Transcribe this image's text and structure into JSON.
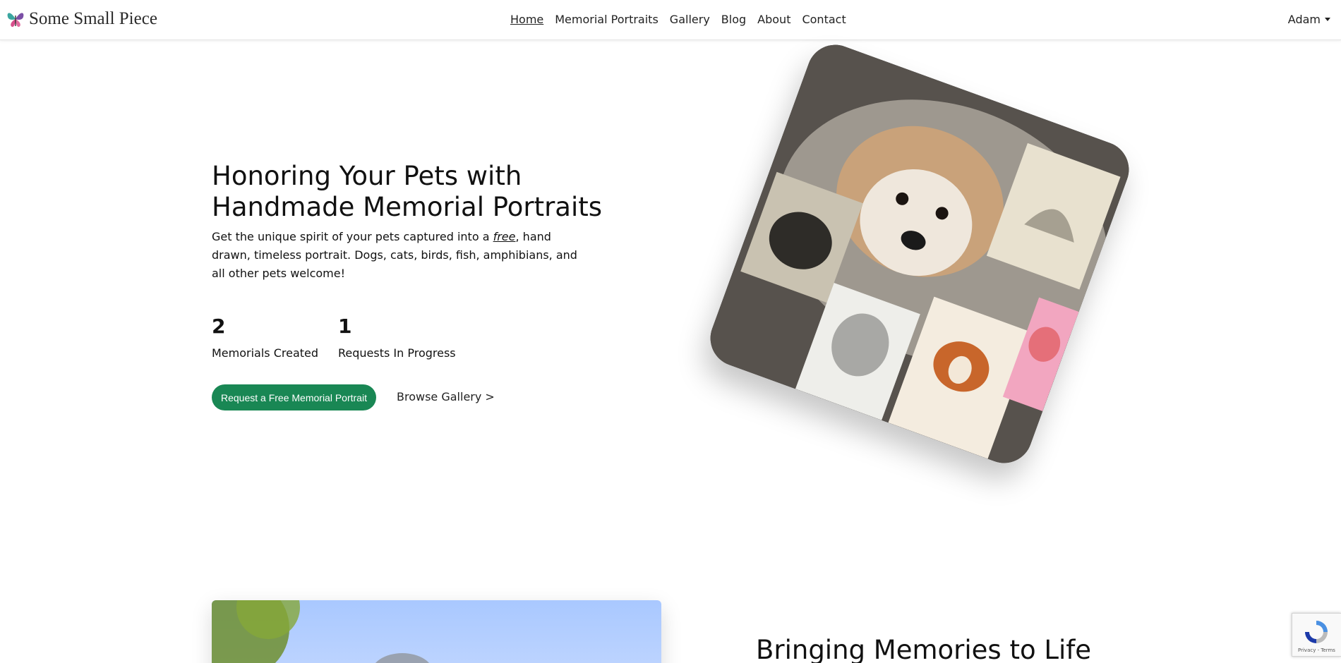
{
  "navbar": {
    "brand": "Some Small Piece",
    "links": [
      "Home",
      "Memorial Portraits",
      "Gallery",
      "Blog",
      "About",
      "Contact"
    ],
    "active_link": "Home",
    "user": "Adam"
  },
  "hero": {
    "title_line1": "Honoring Your Pets with",
    "title_line2": "Handmade Memorial Portraits",
    "subtitle_before": "Get the unique spirit of your pets captured into a ",
    "subtitle_em": "free",
    "subtitle_after": ", hand drawn, timeless portrait. Dogs, cats, birds, fish, amphibians, and all other pets welcome!",
    "stats": [
      {
        "value": "2",
        "label": "Memorials Created"
      },
      {
        "value": "1",
        "label": "Requests In Progress"
      }
    ],
    "cta_label": "Request a Free Memorial Portrait",
    "browse_label": "Browse Gallery >"
  },
  "section2": {
    "title": "Bringing Memories to Life"
  },
  "recaptcha": {
    "terms": "Privacy - Terms"
  },
  "colors": {
    "accent": "#198754"
  }
}
